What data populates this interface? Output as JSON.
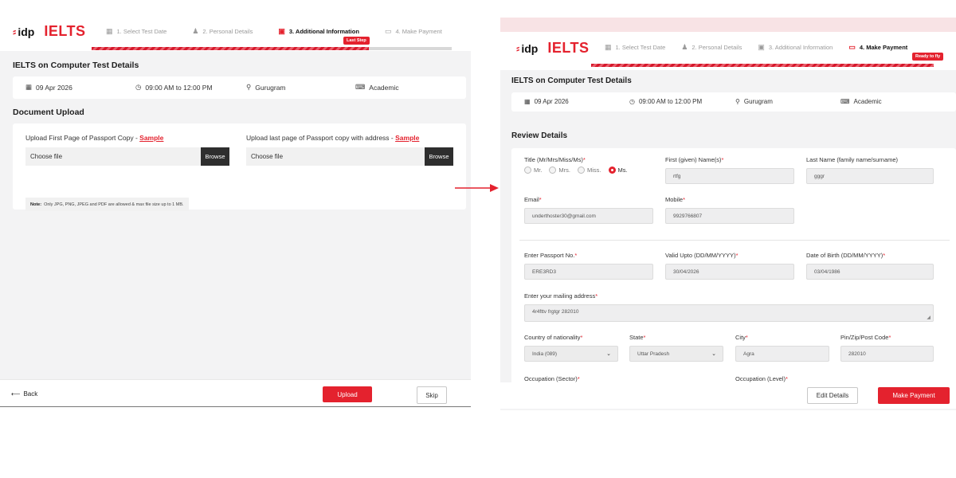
{
  "brand": {
    "idp": "idp",
    "ielts": "IELTS"
  },
  "left": {
    "steps": [
      {
        "label": "1. Select Test Date",
        "icon": "calendar-icon"
      },
      {
        "label": "2. Personal Details",
        "icon": "person-icon"
      },
      {
        "label": "3. Additional Information",
        "icon": "id-card-icon"
      },
      {
        "label": "4. Make Payment",
        "icon": "card-icon"
      }
    ],
    "active_step": 3,
    "progress_fraction": 0.77,
    "step_badge": "Last Step",
    "test_title": "IELTS on Computer Test Details",
    "test": {
      "date": "09 Apr 2026",
      "time": "09:00 AM to 12:00 PM",
      "location": "Gurugram",
      "module": "Academic"
    },
    "doc_title": "Document Upload",
    "upload1": {
      "label": "Upload First Page of Passport Copy - ",
      "sample": "Sample",
      "file": "Choose file",
      "browse": "Browse"
    },
    "upload2": {
      "label": "Upload last page of Passport copy with address - ",
      "sample": "Sample",
      "file": "Choose file",
      "browse": "Browse"
    },
    "note_bold": "Note:",
    "note_text": "Only JPG, PNG, JPEG and PDF are allowed & max file size up to 1 MB.",
    "back": "Back",
    "upload_btn": "Upload",
    "skip_btn": "Skip"
  },
  "right": {
    "steps": [
      {
        "label": "1. Select Test Date",
        "icon": "calendar-icon"
      },
      {
        "label": "2. Personal Details",
        "icon": "person-icon"
      },
      {
        "label": "3. Additional Information",
        "icon": "id-card-icon"
      },
      {
        "label": "4. Make Payment",
        "icon": "card-icon"
      }
    ],
    "active_step": 4,
    "progress_fraction": 1.0,
    "step_badge": "Ready to fly",
    "test_title": "IELTS on Computer Test Details",
    "test": {
      "date": "09 Apr 2026",
      "time": "09:00 AM to 12:00 PM",
      "location": "Gurugram",
      "module": "Academic"
    },
    "review_title": "Review Details",
    "title_label": "Title (Mr/Mrs/Miss/Ms)",
    "title_options": [
      "Mr.",
      "Mrs.",
      "Miss.",
      "Ms."
    ],
    "title_selected": "Ms.",
    "first_name_label": "First (given) Name(s)",
    "first_name": "rtfg",
    "last_name_label": "Last Name (family name/surname)",
    "last_name": "gggr",
    "email_label": "Email",
    "email": "underthoster30@gmail.com",
    "mobile_label": "Mobile",
    "mobile": "9929766807",
    "passport_label": "Enter Passport No.",
    "passport": "ERE3RD3",
    "valid_label": "Valid Upto (DD/MM/YYYY)",
    "valid": "30/04/2026",
    "dob_label": "Date of Birth (DD/MM/YYYY)",
    "dob": "03/04/1986",
    "address_label": "Enter your mailing address",
    "address": "4r4fttv frgtgr 282010",
    "country_label": "Country of nationality",
    "country": "India (089)",
    "state_label": "State",
    "state": "Uttar Pradesh",
    "city_label": "City",
    "city": "Agra",
    "pin_label": "Pin/Zip/Post Code",
    "pin": "282010",
    "occ_sector_label": "Occupation (Sector)",
    "occ_level_label": "Occupation (Level)",
    "edit_btn": "Edit Details",
    "pay_btn": "Make Payment"
  },
  "colors": {
    "accent": "#e4222e",
    "panel_bg": "#f3f3f4",
    "dark_button": "#2e2e2e"
  }
}
